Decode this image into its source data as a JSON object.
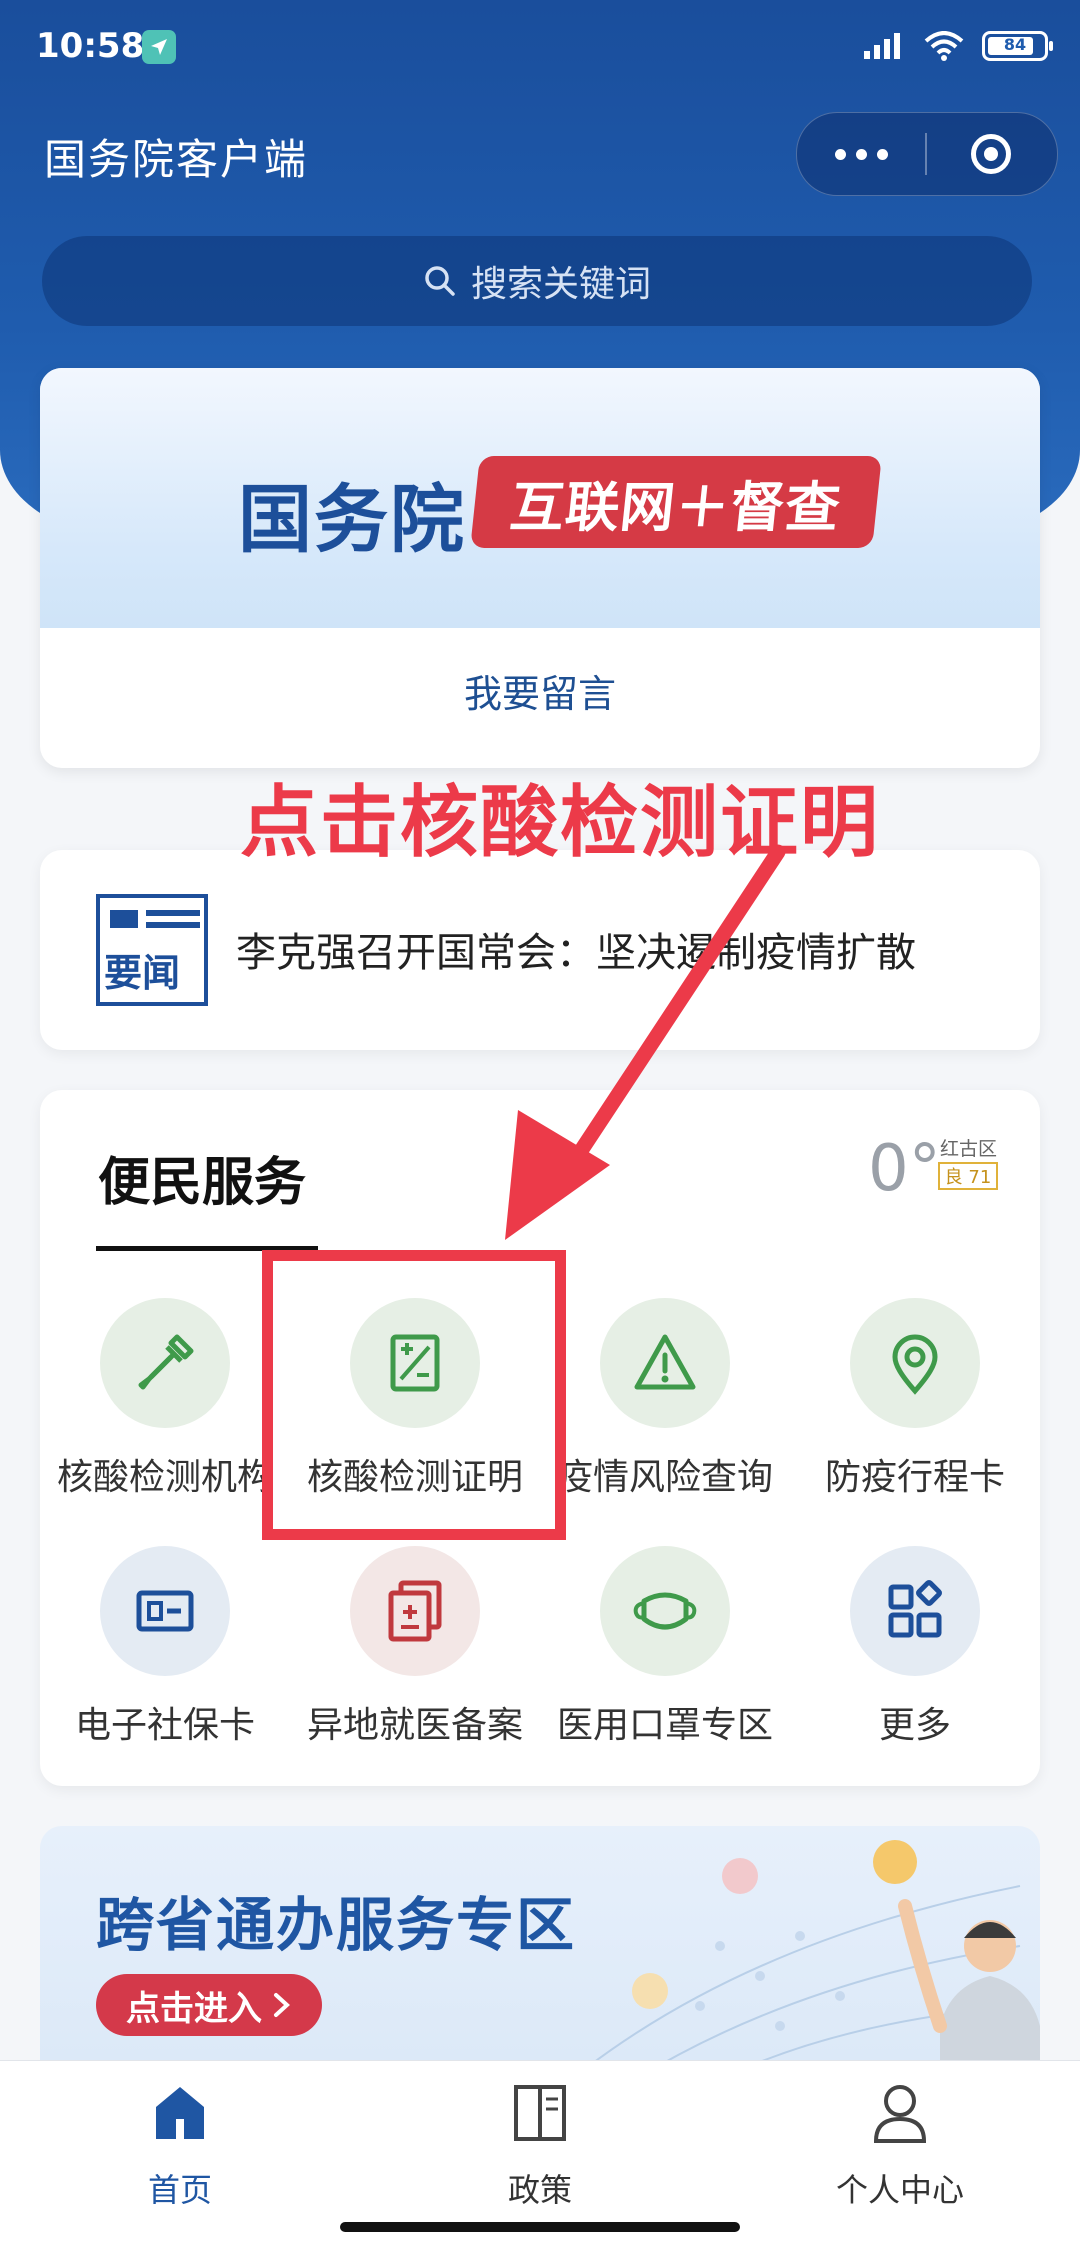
{
  "status_bar": {
    "time": "10:58",
    "battery_level": 0.84,
    "battery_text": "84"
  },
  "header": {
    "title": "国务院客户端"
  },
  "search": {
    "placeholder": "搜索关键词"
  },
  "banner": {
    "title": "国务院",
    "tag": "互联网＋督查",
    "link_label": "我要留言"
  },
  "annotation": {
    "text": "点击核酸检测证明"
  },
  "news": {
    "icon_label": "要闻",
    "headline": "李克强召开国常会：坚决遏制疫情扩散"
  },
  "services": {
    "title": "便民服务",
    "weather": {
      "temperature": "0°",
      "area": "红古区",
      "aqi": "良 71"
    },
    "items": [
      {
        "label": "核酸检测机构",
        "icon": "dropper-icon"
      },
      {
        "label": "核酸检测证明",
        "icon": "certificate-icon"
      },
      {
        "label": "疫情风险查询",
        "icon": "warning-icon"
      },
      {
        "label": "防疫行程卡",
        "icon": "location-pin-icon"
      },
      {
        "label": "电子社保卡",
        "icon": "id-card-icon"
      },
      {
        "label": "异地就医备案",
        "icon": "medical-record-icon"
      },
      {
        "label": "医用口罩专区",
        "icon": "mask-icon"
      },
      {
        "label": "更多",
        "icon": "grid-icon"
      }
    ]
  },
  "promo": {
    "title": "跨省通办服务专区",
    "button": "点击进入"
  },
  "tabbar": {
    "tabs": [
      {
        "label": "首页",
        "icon": "home-icon",
        "active": true
      },
      {
        "label": "政策",
        "icon": "book-icon",
        "active": false
      },
      {
        "label": "个人中心",
        "icon": "user-icon",
        "active": false
      }
    ]
  },
  "colors": {
    "brand_blue": "#1f5cae",
    "annotation_red": "#ec3a49",
    "icon_green": "#3f9a4a",
    "icon_blue": "#1d4f9a",
    "icon_red": "#c0393e"
  }
}
